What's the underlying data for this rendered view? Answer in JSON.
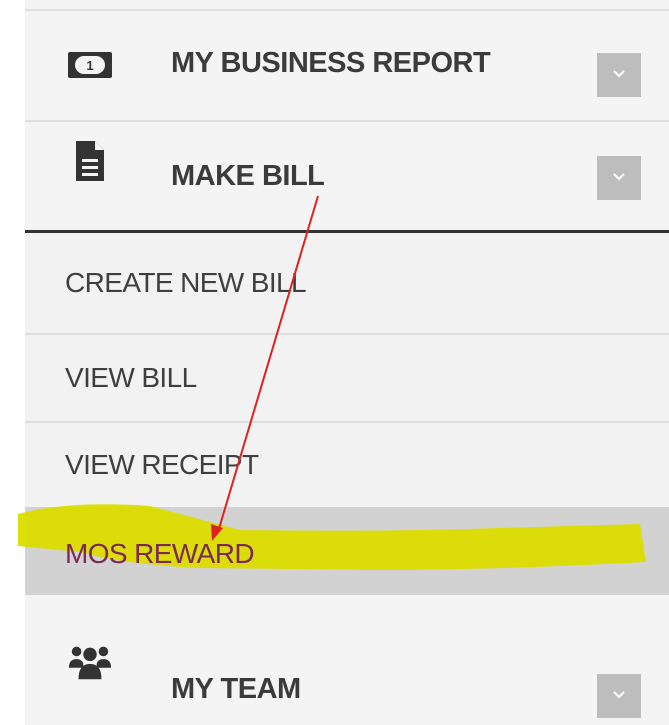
{
  "menu": {
    "main_items": [
      {
        "label": "MY BUSINESS REPORT",
        "icon": "money-bill-icon",
        "toggle_icon": "chevron-down-icon"
      },
      {
        "label": "MAKE BILL",
        "icon": "document-icon",
        "toggle_icon": "chevron-down-icon"
      },
      {
        "label": "MY TEAM",
        "icon": "users-icon",
        "toggle_icon": "chevron-down-icon"
      }
    ],
    "sub_items": [
      {
        "label": "CREATE NEW BILL"
      },
      {
        "label": "VIEW BILL"
      },
      {
        "label": "VIEW RECEIPT"
      },
      {
        "label": "MOS REWARD",
        "active": true
      }
    ]
  },
  "annotations": {
    "highlight_color": "#dcdc00",
    "arrow_color": "#e02020"
  },
  "colors": {
    "menu_bg": "#f4f4f4",
    "active_bg": "#d2d2d2",
    "toggle_bg": "#bdbdbd",
    "active_text": "#7a2a55"
  }
}
